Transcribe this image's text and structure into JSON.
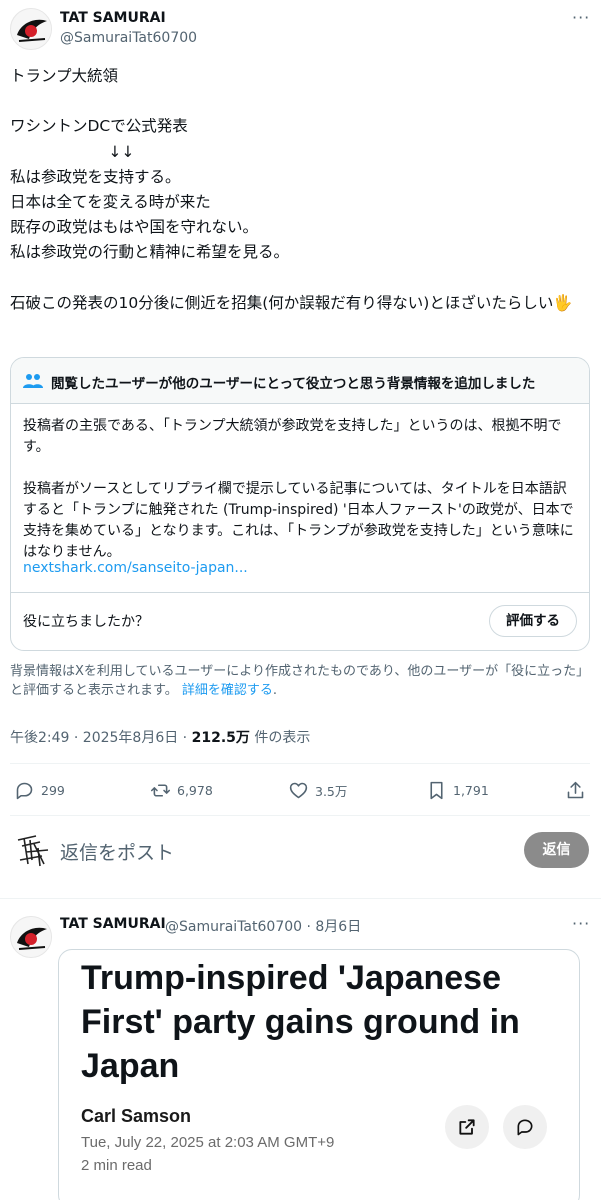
{
  "main_post": {
    "author_name": "TAT SAMURAI",
    "author_handle": "@SamuraiTat60700",
    "text": "トランプ大統領\n\nワシントンDCで公式発表\n                    ↓↓\n私は参政党を支持する。\n日本は全てを変える時が来た\n既存の政党はもはや国を守れない。\n私は参政党の行動と精神に希望を見る。\n\n石破この発表の10分後に側近を招集(何か誤報だ有り得ない)とほざいたらしい🖐",
    "more_label": "···"
  },
  "community_note": {
    "title": "閲覧したユーザーが他のユーザーにとって役立つと思う背景情報を追加しました",
    "body": "投稿者の主張である、「トランプ大統領が参政党を支持した」というのは、根拠不明です。\n\n投稿者がソースとしてリプライ欄で提示している記事については、タイトルを日本語訳すると「トランプに触発された (Trump-inspired) '日本人ファースト'の政党が、日本で支持を集めている」となります。これは、「トランプが参政党を支持した」という意味にはなりません。",
    "link": "nextshark.com/sanseito-japan...",
    "question": "役に立ちましたか？",
    "rate_label": "評価する",
    "footer_text": "背景情報はXを利用しているユーザーにより作成されたものであり、他のユーザーが「役に立った」と評価すると表示されます。",
    "footer_link": "詳細を確認する"
  },
  "meta": {
    "time_date": "午後2:49 · 2025年8月6日 · ",
    "views_count": "212.5万",
    "views_label": " 件の表示"
  },
  "actions": {
    "replies": "299",
    "reposts": "6,978",
    "likes": "3.5万",
    "bookmarks": "1,791"
  },
  "reply_box": {
    "placeholder": "返信をポスト",
    "button_label": "返信"
  },
  "reply_post": {
    "author_name": "TAT SAMURAI",
    "author_handle_date": "@SamuraiTat60700 · 8月6日",
    "more_label": "···",
    "card": {
      "headline": "Trump-inspired 'Japanese First' party gains ground in Japan",
      "author": "Carl Samson",
      "date": "Tue, July 22, 2025 at 2:03 AM GMT+9",
      "read_time": "2 min read"
    }
  },
  "colors": {
    "accent": "#1d9bf0",
    "secondary_text": "#536471",
    "border": "#cfd9de"
  }
}
